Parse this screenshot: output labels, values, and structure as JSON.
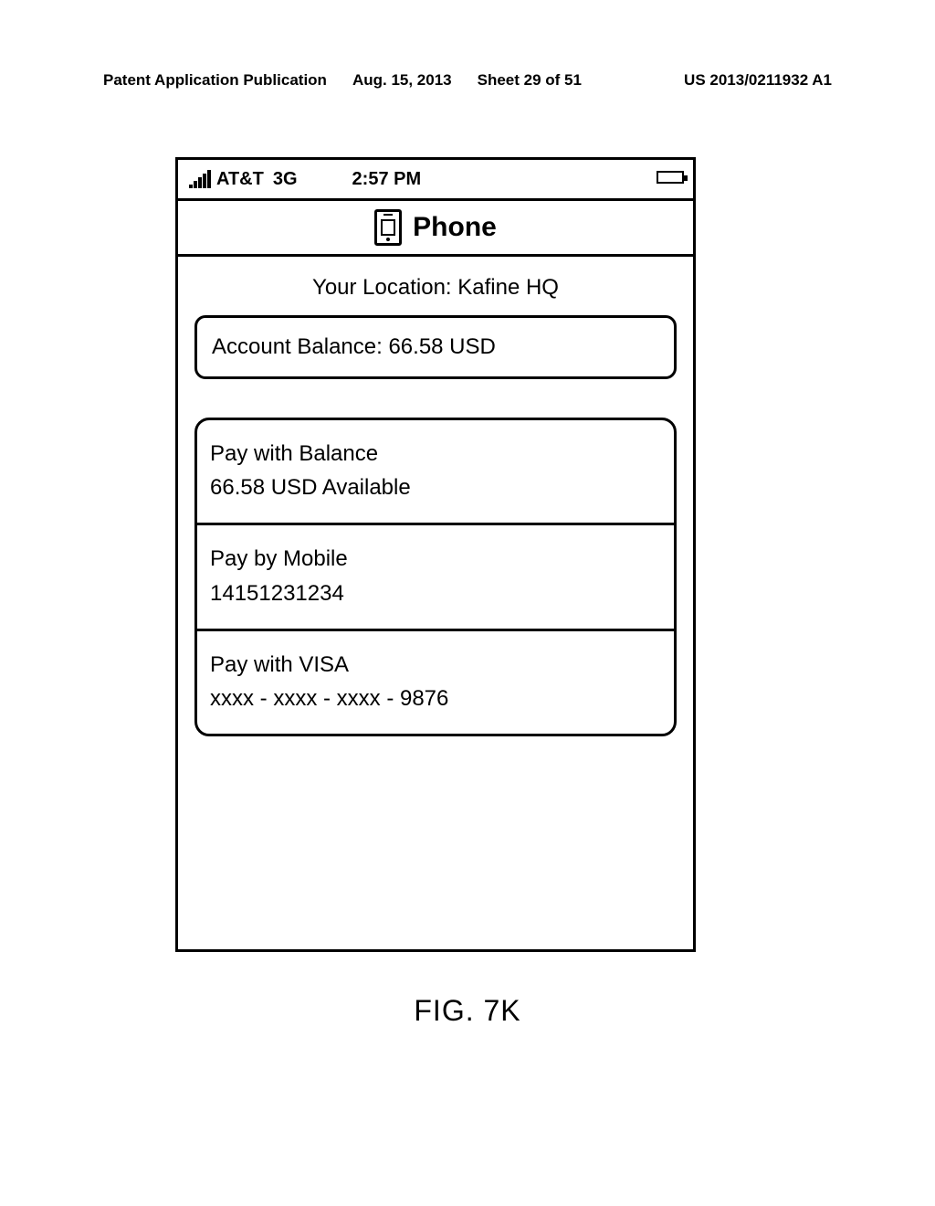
{
  "header": {
    "publication": "Patent Application Publication",
    "date": "Aug. 15, 2013",
    "sheet": "Sheet 29 of 51",
    "pubno": "US 2013/0211932 A1"
  },
  "statusbar": {
    "carrier": "AT&T",
    "network": "3G",
    "time": "2:57 PM"
  },
  "titlebar": {
    "title": "Phone"
  },
  "location": {
    "prefix": "Your Location: ",
    "name": "Kafine HQ"
  },
  "balance": {
    "label": "Account Balance: ",
    "amount": "66.58 USD"
  },
  "options": [
    {
      "title": "Pay with Balance",
      "subtitle": "66.58 USD Available"
    },
    {
      "title": "Pay by Mobile",
      "subtitle": "14151231234"
    },
    {
      "title": "Pay with VISA",
      "subtitle": "xxxx - xxxx - xxxx - 9876"
    }
  ],
  "figure": "FIG. 7K"
}
